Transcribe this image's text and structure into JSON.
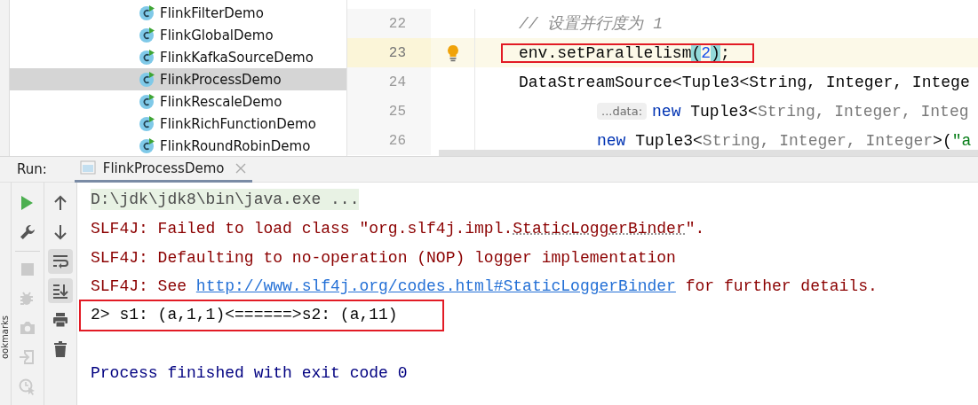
{
  "project_tree": {
    "items": [
      {
        "label": "FlinkFilterDemo",
        "selected": false
      },
      {
        "label": "FlinkGlobalDemo",
        "selected": false
      },
      {
        "label": "FlinkKafkaSourceDemo",
        "selected": false
      },
      {
        "label": "FlinkProcessDemo",
        "selected": true
      },
      {
        "label": "FlinkRescaleDemo",
        "selected": false
      },
      {
        "label": "FlinkRichFunctionDemo",
        "selected": false
      },
      {
        "label": "FlinkRoundRobinDemo",
        "selected": false
      }
    ]
  },
  "editor": {
    "lines": [
      {
        "number": "22",
        "continuation": false,
        "current": false,
        "boxed": false,
        "bulb": false,
        "tokens": [
          {
            "text": "// 设置并行度为 1",
            "kind": "comment"
          }
        ]
      },
      {
        "number": "23",
        "continuation": false,
        "current": true,
        "boxed": true,
        "bulb": true,
        "tokens": [
          {
            "text": "env.setParallelism",
            "kind": "plain"
          },
          {
            "text": "(",
            "kind": "match"
          },
          {
            "text": "2",
            "kind": "number"
          },
          {
            "text": ")",
            "kind": "match"
          },
          {
            "text": ";",
            "kind": "plain"
          }
        ]
      },
      {
        "number": "24",
        "continuation": false,
        "current": false,
        "boxed": false,
        "bulb": false,
        "tokens": [
          {
            "text": "DataStreamSource<Tuple3<String, Integer, Intege",
            "kind": "plain"
          }
        ]
      },
      {
        "number": "25",
        "continuation": true,
        "current": false,
        "boxed": false,
        "bulb": false,
        "tokens": [
          {
            "text": "...data:",
            "kind": "hint"
          },
          {
            "text": "new",
            "kind": "keyword"
          },
          {
            "text": " Tuple3<",
            "kind": "plain"
          },
          {
            "text": "String, Integer, Integ",
            "kind": "grey"
          }
        ]
      },
      {
        "number": "26",
        "continuation": true,
        "current": false,
        "boxed": false,
        "bulb": false,
        "tokens": [
          {
            "text": "new",
            "kind": "keyword"
          },
          {
            "text": " Tuple3<",
            "kind": "plain"
          },
          {
            "text": "String, Integer, Integer",
            "kind": "grey"
          },
          {
            "text": ">(",
            "kind": "plain"
          },
          {
            "text": "\"a",
            "kind": "string"
          }
        ]
      }
    ]
  },
  "run_panel": {
    "label": "Run:",
    "tab": {
      "label": "FlinkProcessDemo",
      "selected": true
    },
    "side_label": "ookmarks",
    "toolbar_left": [
      {
        "kind": "run",
        "disabled": false
      },
      {
        "kind": "wrench",
        "disabled": false
      },
      {
        "kind": "divider"
      },
      {
        "kind": "stop",
        "disabled": true
      },
      {
        "kind": "bug",
        "disabled": true
      },
      {
        "kind": "camera",
        "disabled": true
      },
      {
        "kind": "enter",
        "disabled": true
      },
      {
        "kind": "clock",
        "disabled": true
      }
    ],
    "toolbar_right": [
      {
        "kind": "up",
        "on": false
      },
      {
        "kind": "down",
        "on": false
      },
      {
        "kind": "wrap",
        "on": true
      },
      {
        "kind": "scroll-end",
        "on": true
      },
      {
        "kind": "print",
        "on": false
      },
      {
        "kind": "trash",
        "on": false
      }
    ],
    "console": [
      {
        "kind": "command",
        "boxed": false,
        "parts": [
          {
            "text": "D:\\jdk\\jdk8\\bin\\java.exe ...",
            "kind": "text"
          }
        ]
      },
      {
        "kind": "error",
        "boxed": false,
        "parts": [
          {
            "text": "SLF4J: Failed to load class \"org.slf4j.impl.",
            "kind": "text"
          },
          {
            "text": "StaticLoggerBinder",
            "kind": "dotted"
          },
          {
            "text": "\".",
            "kind": "text"
          }
        ]
      },
      {
        "kind": "error",
        "boxed": false,
        "parts": [
          {
            "text": "SLF4J: Defaulting to no-operation (NOP) logger implementation",
            "kind": "text"
          }
        ]
      },
      {
        "kind": "error",
        "boxed": false,
        "parts": [
          {
            "text": "SLF4J: See ",
            "kind": "text"
          },
          {
            "text": "http://www.slf4j.org/codes.html#StaticLoggerBinder",
            "kind": "link"
          },
          {
            "text": " for further details.",
            "kind": "text"
          }
        ]
      },
      {
        "kind": "output",
        "boxed": true,
        "parts": [
          {
            "text": "2> s1: (a,1,1)<======>s2: (a,11)",
            "kind": "text"
          }
        ]
      },
      {
        "kind": "blank"
      },
      {
        "kind": "exit",
        "boxed": false,
        "parts": [
          {
            "text": "Process finished with exit code 0",
            "kind": "text"
          }
        ]
      }
    ]
  }
}
